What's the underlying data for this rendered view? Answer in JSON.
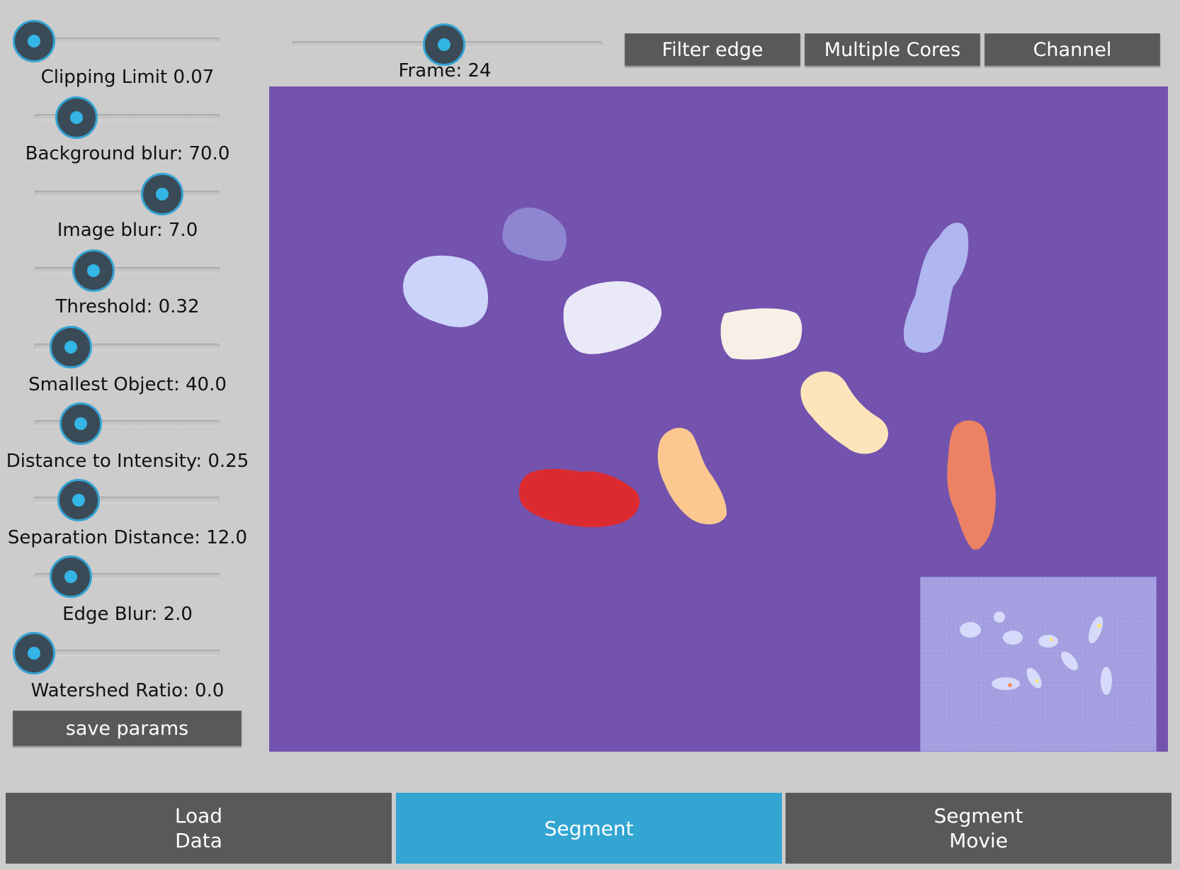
{
  "frame_slider": {
    "label": "Frame: 24",
    "fraction": 0.49
  },
  "toolbar": {
    "filter_edge": "Filter edge",
    "multiple_cores": "Multiple Cores",
    "channel": "Channel"
  },
  "params": [
    {
      "label": "Clipping Limit 0.07",
      "fraction": 0.0
    },
    {
      "label": "Background blur: 70.0",
      "fraction": 0.23
    },
    {
      "label": "Image blur: 7.0",
      "fraction": 0.69
    },
    {
      "label": "Threshold: 0.32",
      "fraction": 0.32
    },
    {
      "label": "Smallest Object: 40.0",
      "fraction": 0.2
    },
    {
      "label": "Distance to Intensity: 0.25",
      "fraction": 0.25
    },
    {
      "label": "Separation Distance: 12.0",
      "fraction": 0.24
    },
    {
      "label": "Edge Blur: 2.0",
      "fraction": 0.2
    },
    {
      "label": "Watershed Ratio: 0.0",
      "fraction": 0.0
    }
  ],
  "save_params": "save params",
  "tabs": [
    {
      "line1": "Load",
      "line2": "Data",
      "active": false
    },
    {
      "line1": "Segment",
      "line2": "",
      "active": true
    },
    {
      "line1": "Segment",
      "line2": "Movie",
      "active": false
    }
  ],
  "colors": {
    "background": "#cccccc",
    "button": "#595959",
    "accent": "#33a5d2",
    "viewer_background": "#7353ae",
    "thumbnail": "#a39ee0"
  },
  "segments": [
    {
      "color": "#8f86d2"
    },
    {
      "color": "#ccd4fb"
    },
    {
      "color": "#e9e9f8"
    },
    {
      "color": "#f8f0e6"
    },
    {
      "color": "#b0b6ef"
    },
    {
      "color": "#fde4bb"
    },
    {
      "color": "#fdc890"
    },
    {
      "color": "#dc2b30"
    },
    {
      "color": "#ec8264"
    }
  ]
}
